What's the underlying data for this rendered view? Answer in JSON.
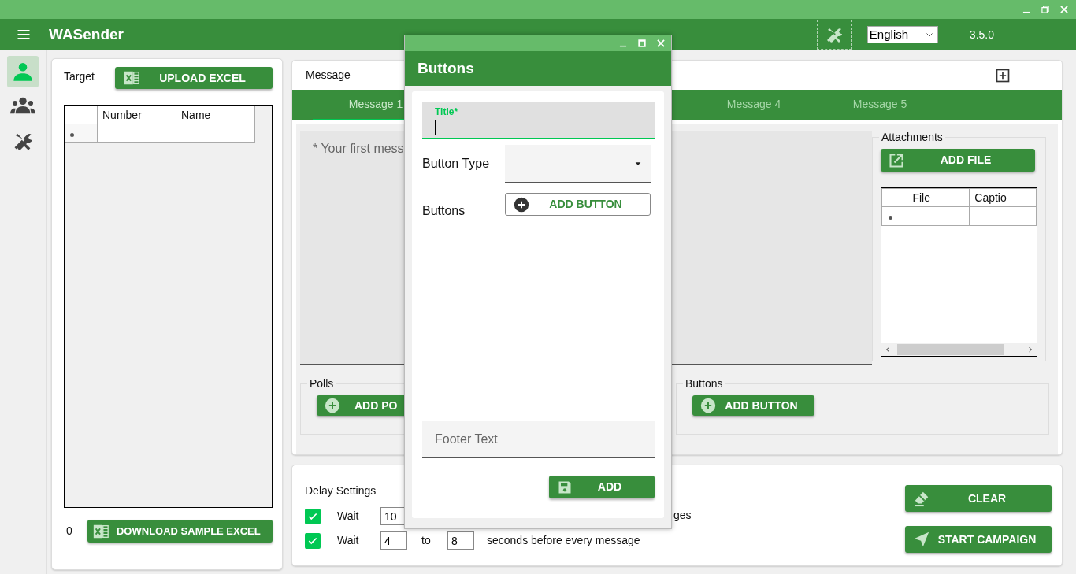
{
  "app_bar": {
    "title": "WASender",
    "language": "English",
    "version": "3.5.0"
  },
  "sidebar": {
    "items": [
      {
        "kind": "contact",
        "selected": true
      },
      {
        "kind": "group",
        "selected": false
      },
      {
        "kind": "tools",
        "selected": false
      }
    ]
  },
  "target": {
    "label": "Target",
    "upload_button": "UPLOAD EXCEL",
    "columns": [
      "Number",
      "Name"
    ],
    "count": "0",
    "download_button": "DOWNLOAD SAMPLE EXCEL"
  },
  "message": {
    "label": "Message",
    "tabs": [
      {
        "label": "Message 1",
        "selected": true
      },
      {
        "label": "Message 4",
        "selected": false
      },
      {
        "label": "Message 5",
        "selected": false
      }
    ],
    "placeholder": "* Your first mess",
    "attachments": {
      "label": "Attachments",
      "button": "ADD FILE",
      "columns": [
        "File",
        "Captio"
      ]
    },
    "polls": {
      "label": "Polls",
      "button": "ADD PO"
    },
    "buttons": {
      "label": "Buttons",
      "button": "ADD BUTTON"
    }
  },
  "delay": {
    "label": "Delay Settings",
    "rows": [
      {
        "checked": true,
        "label": "Wait",
        "from": "10",
        "tail": "ges"
      },
      {
        "checked": true,
        "label": "Wait",
        "from": "4",
        "to_label": "to",
        "to": "8",
        "tail": "seconds before every message"
      }
    ]
  },
  "actions": [
    {
      "kind": "clear",
      "label": "CLEAR"
    },
    {
      "kind": "start",
      "label": "START CAMPAIGN"
    }
  ],
  "dialog": {
    "title": "Buttons",
    "title_field": {
      "label": "Title*"
    },
    "button_type_label": "Button Type",
    "buttons_label": "Buttons",
    "add_button": "ADD BUTTON",
    "footer": {
      "placeholder": "Footer Text"
    },
    "submit": "ADD"
  }
}
